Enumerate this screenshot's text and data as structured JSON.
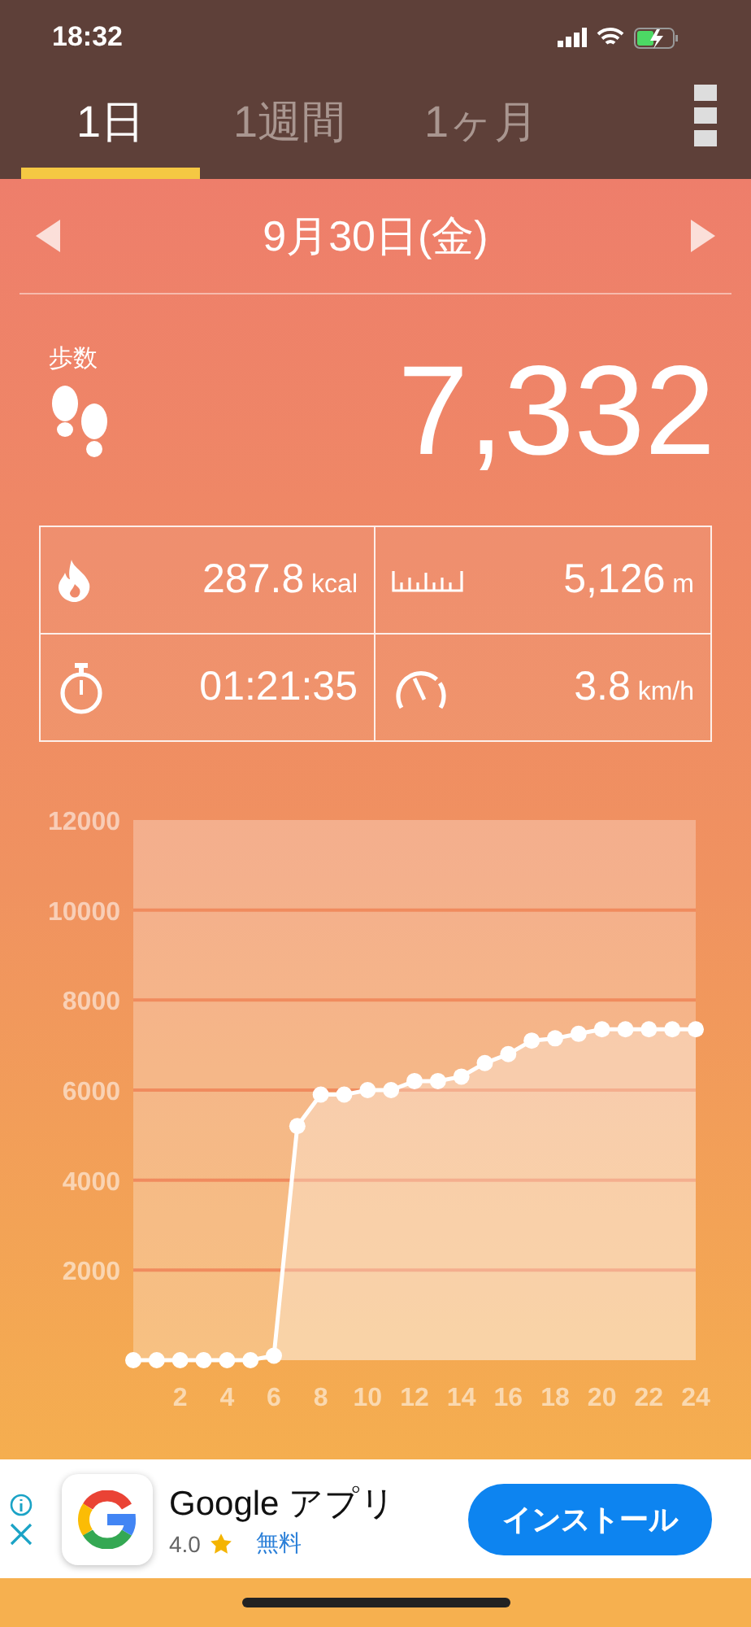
{
  "status_bar": {
    "time": "18:32"
  },
  "tabs": [
    {
      "label": "1日",
      "selected": true
    },
    {
      "label": "1週間",
      "selected": false
    },
    {
      "label": "1ヶ月",
      "selected": false
    }
  ],
  "date_nav": {
    "date": "9月30日(金)"
  },
  "steps": {
    "label": "歩数",
    "value": "7,332"
  },
  "stats": [
    {
      "kind": "calories",
      "value": "287.8",
      "unit": "kcal"
    },
    {
      "kind": "distance",
      "value": "5,126",
      "unit": "m"
    },
    {
      "kind": "duration",
      "value": "01:21:35"
    },
    {
      "kind": "speed",
      "value": "3.8",
      "unit": "km/h"
    }
  ],
  "chart": {
    "chart_data": {
      "type": "area",
      "x": [
        0,
        1,
        2,
        3,
        4,
        5,
        6,
        7,
        8,
        9,
        10,
        11,
        12,
        13,
        14,
        15,
        16,
        17,
        18,
        19,
        20,
        21,
        22,
        23,
        24
      ],
      "series": [
        {
          "color": "#ffffff",
          "values": [
            0,
            0,
            0,
            0,
            0,
            0,
            100,
            5200,
            5900,
            5900,
            6000,
            6000,
            6200,
            6200,
            6300,
            6600,
            6800,
            7100,
            7150,
            7250,
            7350,
            7350,
            7350,
            7350,
            7350
          ]
        }
      ],
      "grid": true,
      "xlim": [
        0,
        24
      ],
      "ylim": [
        0,
        12000
      ],
      "xticks": [
        2,
        4,
        6,
        8,
        10,
        12,
        14,
        16,
        18,
        20,
        22,
        24
      ],
      "yticks": [
        2000,
        4000,
        6000,
        8000,
        10000,
        12000
      ]
    }
  },
  "ad": {
    "title": "Google アプリ",
    "rating": "4.0",
    "price": "無料",
    "button": "インストール"
  }
}
